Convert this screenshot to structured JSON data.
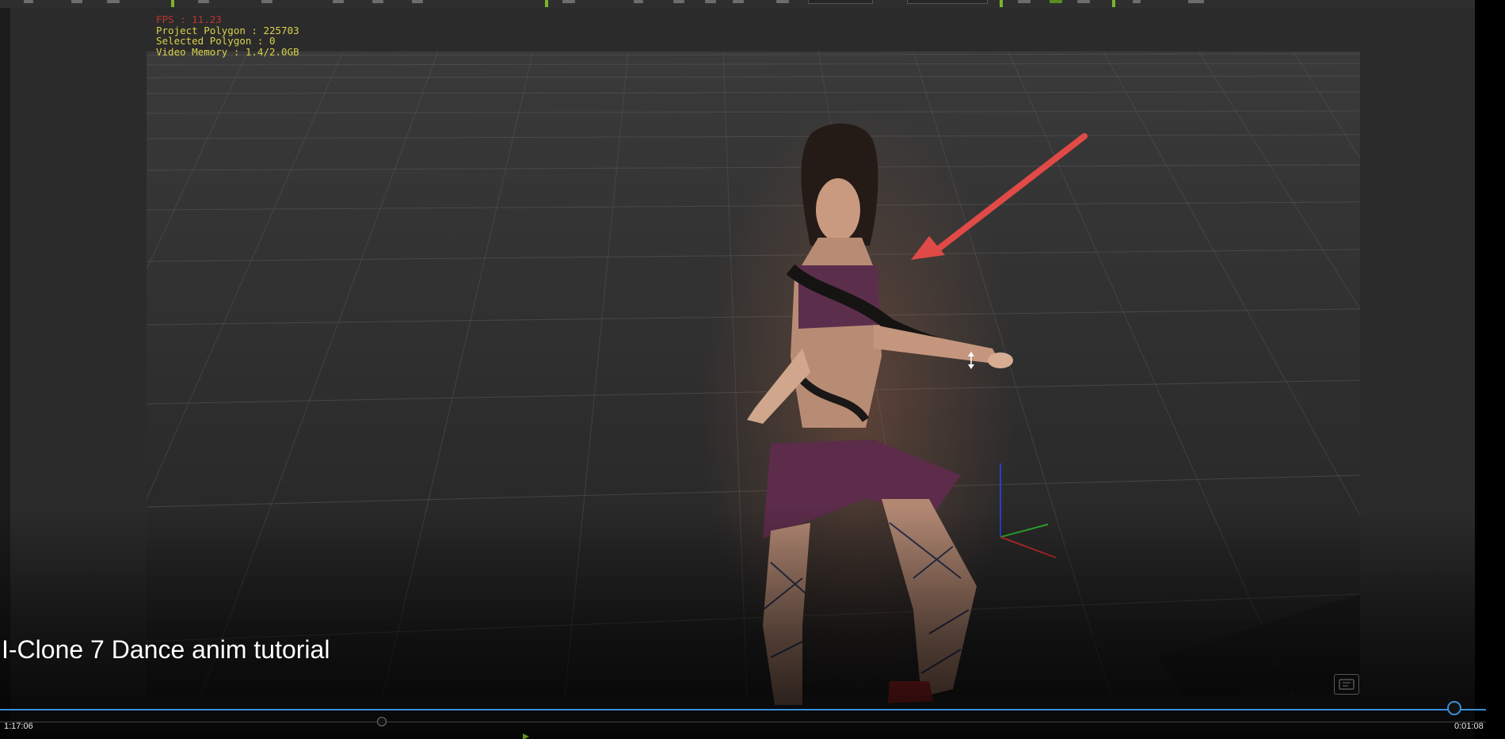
{
  "video": {
    "title": "I-Clone 7 Dance anim tutorial",
    "elapsed": "1:17:06",
    "remaining": "0:01:08",
    "progress_fraction": 0.97
  },
  "viewport_stats": {
    "fps": "FPS : 11.23",
    "project_polygon": "Project Polygon : 225703",
    "selected_polygon": "Selected Polygon : 0",
    "video_memory": "Video Memory : 1.4/2.0GB"
  },
  "icons": {
    "captions": "captions-icon",
    "annotation": "red-arrow-annotation-icon",
    "gizmo": "transform-axis-gizmo-icon",
    "cursor": "resize-vertical-cursor-icon"
  },
  "colors": {
    "progress": "#3a8fd8",
    "stats_text": "#d8d24a",
    "fps_text": "#c0342e",
    "annotation": "#e04a47",
    "toolbar_accent": "#7ab52a"
  }
}
